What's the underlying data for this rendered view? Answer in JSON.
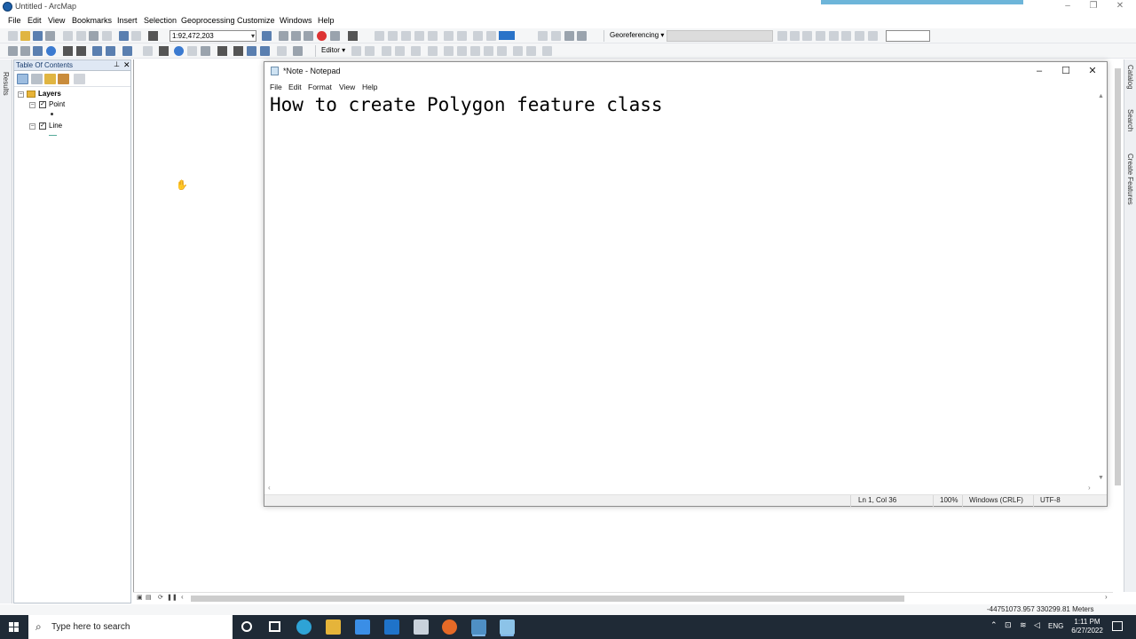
{
  "app": {
    "title": "Untitled - ArcMap",
    "menu": [
      "File",
      "Edit",
      "View",
      "Bookmarks",
      "Insert",
      "Selection",
      "Geoprocessing",
      "Customize",
      "Windows",
      "Help"
    ]
  },
  "toolbar": {
    "scale": "1:92,472,203",
    "editor_label": "Editor",
    "georef_label": "Georeferencing"
  },
  "toc": {
    "title": "Table Of Contents",
    "root": "Layers",
    "layers": [
      {
        "name": "Point",
        "checked": true
      },
      {
        "name": "Line",
        "checked": true
      }
    ]
  },
  "dock": {
    "left_tab": "Results",
    "right_tabs": [
      "Catalog",
      "Search",
      "Create Features"
    ]
  },
  "notepad": {
    "title": "*Note - Notepad",
    "menu": [
      "File",
      "Edit",
      "Format",
      "View",
      "Help"
    ],
    "text": "How to create Polygon feature class",
    "status": {
      "position": "Ln 1, Col 36",
      "zoom": "100%",
      "line_endings": "Windows (CRLF)",
      "encoding": "UTF-8"
    }
  },
  "map_status": {
    "coordinates": "-44751073.957  330299.81 Meters"
  },
  "taskbar": {
    "search_placeholder": "Type here to search",
    "language": "ENG",
    "time": "1:11 PM",
    "date": "6/27/2022",
    "apps": [
      "edge-icon",
      "file-explorer-icon",
      "store-icon",
      "mail-icon",
      "arcgis-icon",
      "firefox-icon",
      "arcmap-icon",
      "notepad-icon"
    ]
  },
  "colors": {
    "taskbar": "#1f2a36",
    "toc_header": "#dfe8f4",
    "progress": "#6db5d9"
  }
}
